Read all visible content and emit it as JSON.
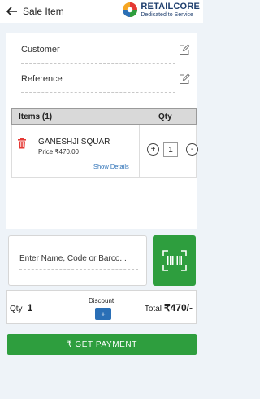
{
  "header": {
    "title": "Sale Item",
    "brand_name": "RETAILCORE",
    "brand_tagline": "Dedicated to Service"
  },
  "form": {
    "customer_label": "Customer",
    "reference_label": "Reference"
  },
  "items_table": {
    "items_header": "Items (1)",
    "qty_header": "Qty",
    "rows": [
      {
        "name": "GANESHJI SQUAR",
        "price": "Price ₹470.00",
        "show_details": "Show Details",
        "plus": "+",
        "qty": "1",
        "minus": "-"
      }
    ]
  },
  "search": {
    "placeholder": "Enter Name, Code or Barco..."
  },
  "summary": {
    "qty_label": "Qty",
    "qty_value": "1",
    "discount_label": "Discount",
    "discount_button": "+",
    "total_label": "Total",
    "total_value": "₹470/-"
  },
  "payment": {
    "button_label": "₹ GET PAYMENT"
  },
  "colors": {
    "accent_green": "#2e9e3e",
    "link_blue": "#2a6fb6",
    "delete_red": "#e53935"
  }
}
